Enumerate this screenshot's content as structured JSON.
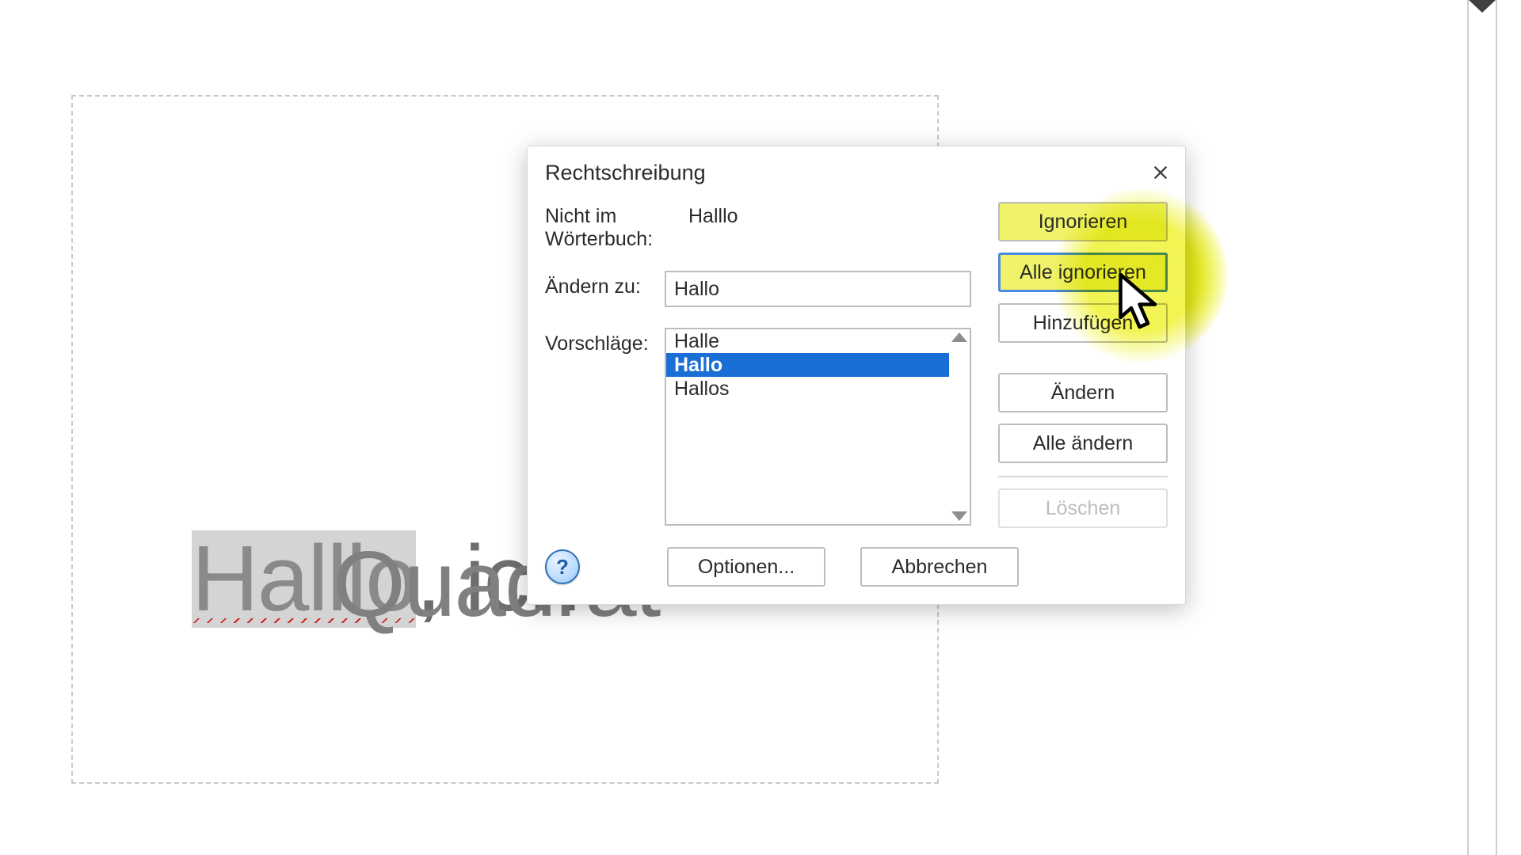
{
  "document": {
    "misspelled_word": "Halllo",
    "after_text": ", ich",
    "line2": "Quadrat"
  },
  "dialog": {
    "title": "Rechtschreibung",
    "labels": {
      "not_in_dict": "Nicht im Wörterbuch:",
      "change_to": "Ändern zu:",
      "suggestions": "Vorschläge:"
    },
    "not_in_dict_value": "Halllo",
    "change_to_value": "Hallo",
    "suggestions": [
      "Halle",
      "Hallo",
      "Hallos"
    ],
    "selected_suggestion_index": 1,
    "buttons": {
      "ignore": "Ignorieren",
      "ignore_all": "Alle ignorieren",
      "add": "Hinzufügen",
      "change": "Ändern",
      "change_all": "Alle ändern",
      "delete": "Löschen",
      "options": "Optionen...",
      "cancel": "Abbrechen"
    },
    "help_symbol": "?"
  }
}
